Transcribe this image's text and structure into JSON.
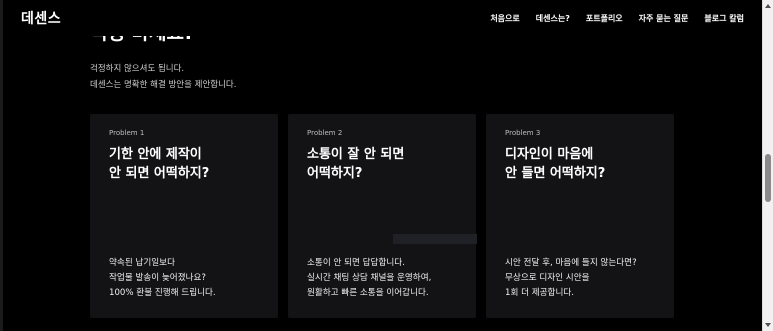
{
  "nav": {
    "logo": "데센스",
    "links": [
      "처음으로",
      "데센스는?",
      "포트폴리오",
      "자주 묻는 질문",
      "블로그 칼럼"
    ]
  },
  "section": {
    "heading": "걱정 마세요!",
    "subtext_line1": "걱정하지 않으셔도 됩니다.",
    "subtext_line2": "데센스는 명확한 해결 방안을 제안합니다."
  },
  "cards": [
    {
      "label": "Problem 1",
      "title_line1": "기한 안에 제작이",
      "title_line2": "안 되면 어떡하지?",
      "desc_line1": "약속된 납기일보다",
      "desc_line2": "작업물 발송이 늦어졌나요?",
      "desc_line3": "100% 환불 진행해 드립니다."
    },
    {
      "label": "Problem 2",
      "title_line1": "소통이 잘 안 되면",
      "title_line2": "어떡하지?",
      "desc_line1": "소통이 안 되면 답답합니다.",
      "desc_line2": "실시간 채팅 상담 채널을 운영하여,",
      "desc_line3": "원활하고 빠른 소통을 이어갑니다."
    },
    {
      "label": "Problem 3",
      "title_line1": "디자인이 마음에",
      "title_line2": "안 들면 어떡하지?",
      "desc_line1": "시안 전달 후, 마음에 들지 않는다면?",
      "desc_line2": "무상으로 디자인 시안을",
      "desc_line3": "1회 더 제공합니다."
    }
  ],
  "colors": {
    "background": "#000000",
    "card": "#131316",
    "text": "#ffffff"
  }
}
